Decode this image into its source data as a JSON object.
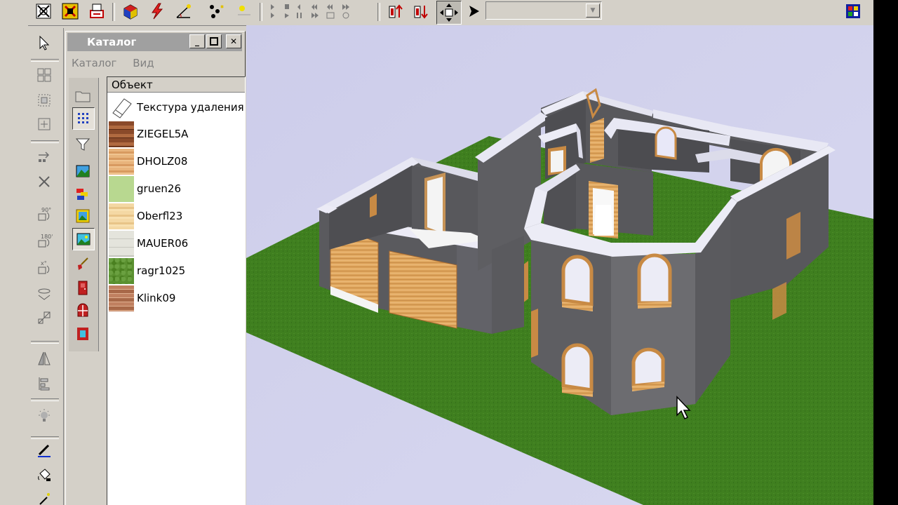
{
  "catalog": {
    "title": "Каталог",
    "menu": [
      "Каталог",
      "Вид"
    ],
    "column_header": "Объект",
    "items": [
      {
        "label": "Текстура удаления",
        "icon": "eraser-icon"
      },
      {
        "label": "ZIEGEL5A",
        "icon": "roof-tile-texture"
      },
      {
        "label": "DHOLZ08",
        "icon": "wood-texture"
      },
      {
        "label": "gruen26",
        "icon": "green-texture"
      },
      {
        "label": "Oberfl23",
        "icon": "light-wood-texture"
      },
      {
        "label": "MAUER06",
        "icon": "wall-texture"
      },
      {
        "label": "ragr1025",
        "icon": "grass-texture"
      },
      {
        "label": "Klink09",
        "icon": "brick-texture"
      }
    ]
  },
  "colors": {
    "window_bg": "#d4d0c8",
    "title_inactive": "#a0a0a0",
    "sky": "#cfd0ea",
    "grass": "#3f7f1f",
    "wall": "#5a5a5e",
    "wall_top": "#e8e8f4",
    "wood": "#d29a55"
  }
}
